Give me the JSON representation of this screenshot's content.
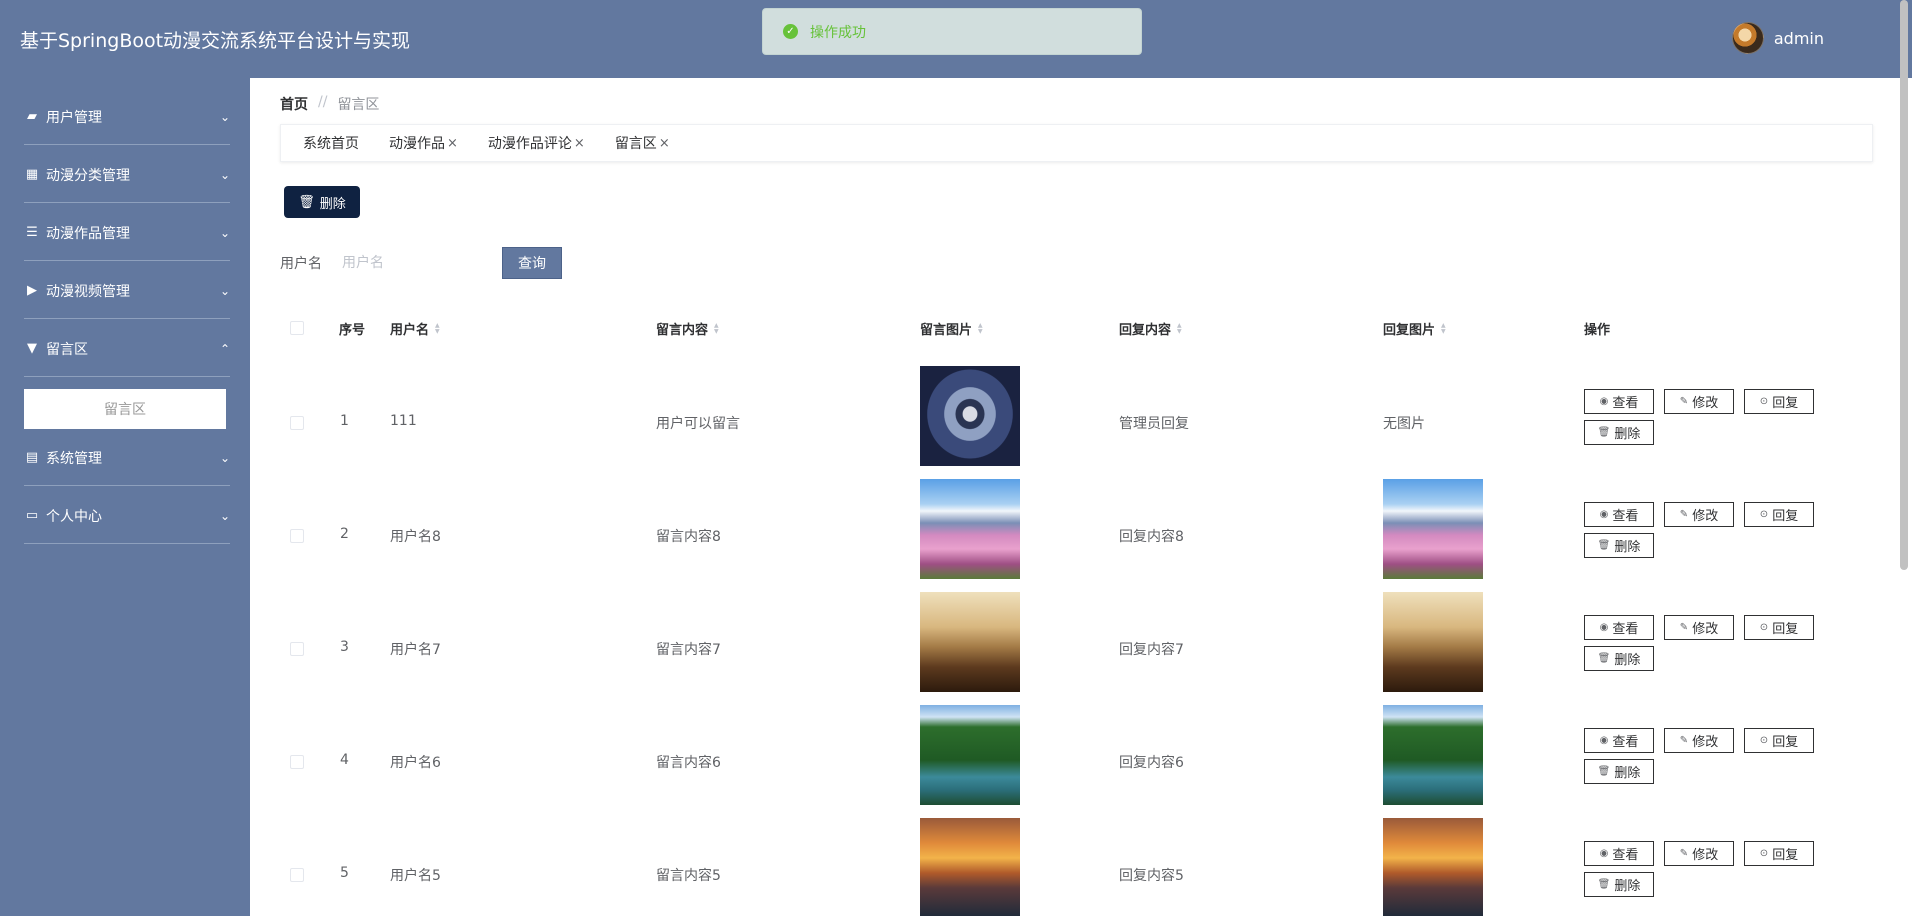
{
  "header": {
    "app_title": "基于SpringBoot动漫交流系统平台设计与实现",
    "username": "admin"
  },
  "toast": {
    "message": "操作成功"
  },
  "sidebar": {
    "items": [
      {
        "label": "用户管理",
        "icon": "chat-icon",
        "expanded": false
      },
      {
        "label": "动漫分类管理",
        "icon": "grid-icon",
        "expanded": false
      },
      {
        "label": "动漫作品管理",
        "icon": "list-icon",
        "expanded": false
      },
      {
        "label": "动漫视频管理",
        "icon": "video-icon",
        "expanded": false
      },
      {
        "label": "留言区",
        "icon": "pin-icon",
        "expanded": true
      },
      {
        "label": "系统管理",
        "icon": "clipboard-icon",
        "expanded": false
      },
      {
        "label": "个人中心",
        "icon": "card-icon",
        "expanded": false
      }
    ],
    "submenu": {
      "label": "留言区"
    }
  },
  "breadcrumb": {
    "home": "首页",
    "separator": "//",
    "current": "留言区"
  },
  "tabs": [
    {
      "label": "系统首页",
      "closable": false
    },
    {
      "label": "动漫作品",
      "closable": true
    },
    {
      "label": "动漫作品评论",
      "closable": true
    },
    {
      "label": "留言区",
      "closable": true
    }
  ],
  "toolbar": {
    "delete_label": "删除"
  },
  "search": {
    "label": "用户名",
    "placeholder": "用户名",
    "value": "",
    "query_label": "查询"
  },
  "table": {
    "columns": {
      "index": "序号",
      "username": "用户名",
      "content": "留言内容",
      "image": "留言图片",
      "reply": "回复内容",
      "reply_image": "回复图片",
      "actions": "操作"
    },
    "rows": [
      {
        "index": "1",
        "username": "111",
        "content": "用户可以留言",
        "image": "ninja",
        "reply": "管理员回复",
        "reply_image": "",
        "no_image_text": "无图片"
      },
      {
        "index": "2",
        "username": "用户名8",
        "content": "留言内容8",
        "image": "fuji",
        "reply": "回复内容8",
        "reply_image": "fuji"
      },
      {
        "index": "3",
        "username": "用户名7",
        "content": "留言内容7",
        "image": "hikers",
        "reply": "回复内容7",
        "reply_image": "hikers"
      },
      {
        "index": "4",
        "username": "用户名6",
        "content": "留言内容6",
        "image": "forest",
        "reply": "回复内容6",
        "reply_image": "forest"
      },
      {
        "index": "5",
        "username": "用户名5",
        "content": "留言内容5",
        "image": "sunset",
        "reply": "回复内容5",
        "reply_image": "sunset"
      }
    ],
    "action_labels": {
      "view": "查看",
      "edit": "修改",
      "reply": "回复",
      "delete": "删除"
    }
  },
  "colors": {
    "header_bg": "#62789f",
    "sidebar_bg": "#62789f",
    "primary_dark": "#0f2241",
    "success": "#67c23a"
  }
}
